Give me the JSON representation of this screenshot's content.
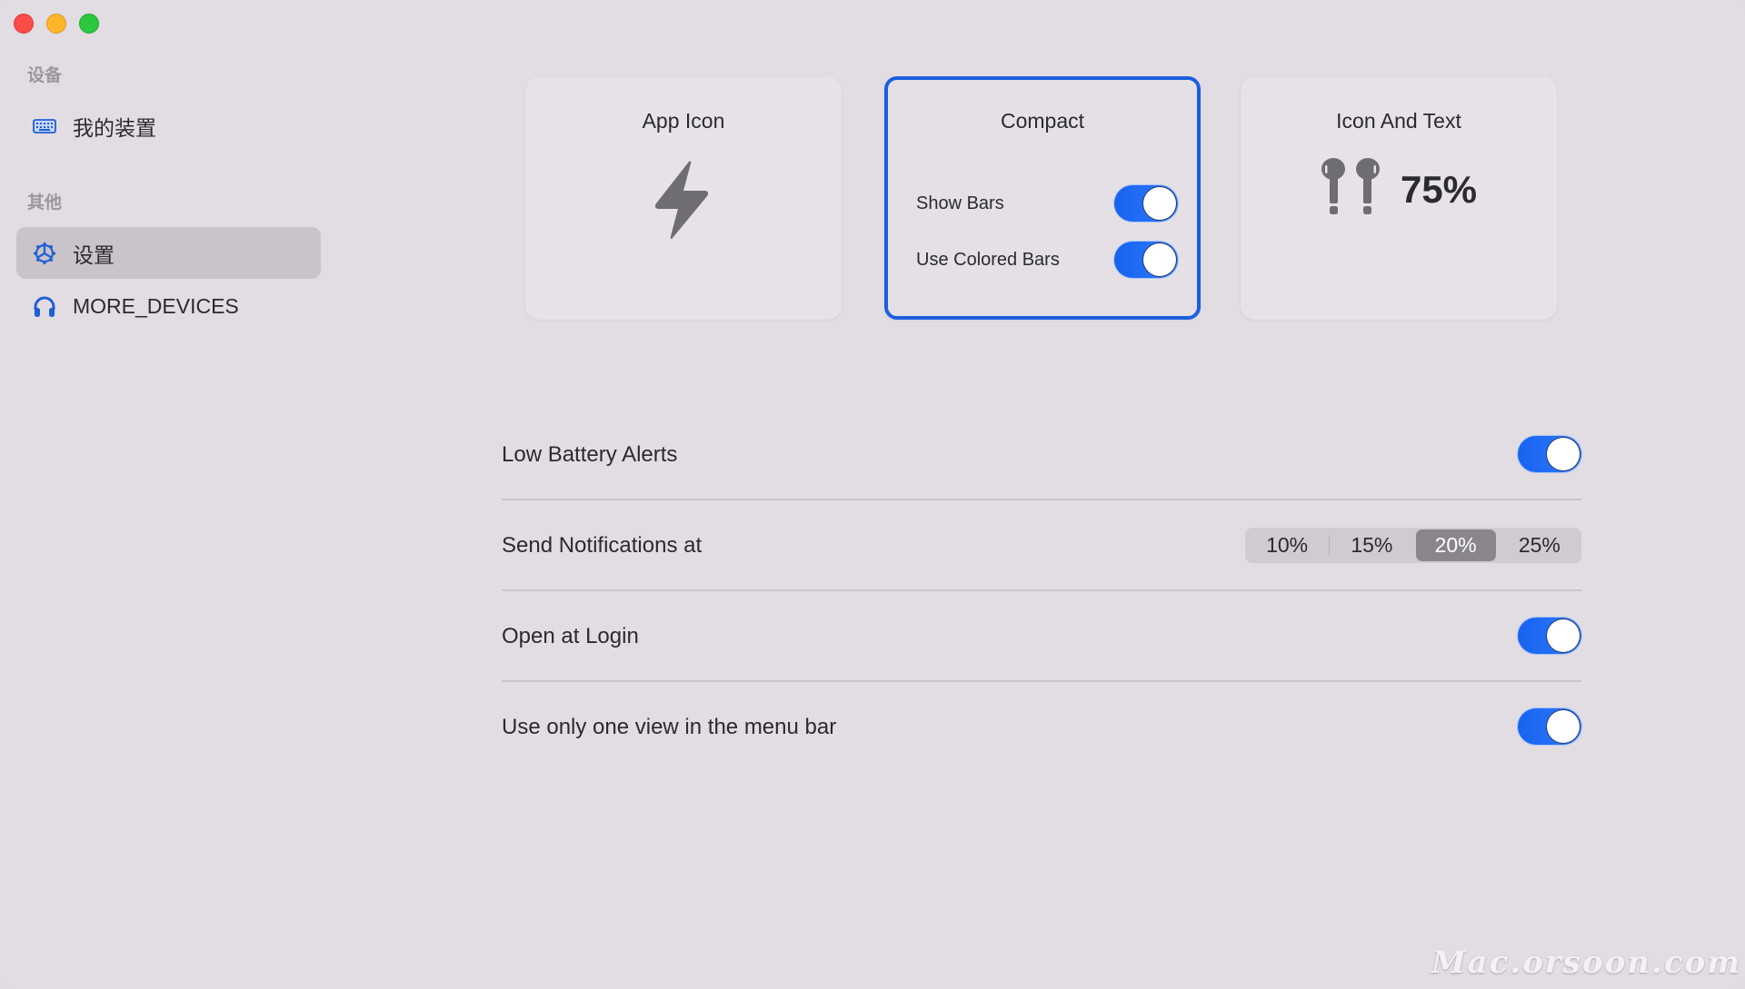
{
  "window": {
    "controls": [
      "close",
      "minimize",
      "maximize"
    ]
  },
  "sidebar": {
    "sections": [
      {
        "header": "设备",
        "items": [
          {
            "label": "我的装置",
            "icon": "keyboard-icon",
            "selected": false
          }
        ]
      },
      {
        "header": "其他",
        "items": [
          {
            "label": "设置",
            "icon": "gear-icon",
            "selected": true
          },
          {
            "label": "MORE_DEVICES",
            "icon": "headphones-icon",
            "selected": false
          }
        ]
      }
    ]
  },
  "display_modes": {
    "selected": "Compact",
    "cards": [
      {
        "title": "App Icon",
        "icon": "bolt-icon"
      },
      {
        "title": "Compact",
        "options": [
          {
            "label": "Show Bars",
            "enabled": true
          },
          {
            "label": "Use Colored Bars",
            "enabled": true
          }
        ]
      },
      {
        "title": "Icon And Text",
        "icon": "airpods-icon",
        "value": "75%"
      }
    ]
  },
  "settings": {
    "low_battery_alerts": {
      "label": "Low Battery Alerts",
      "enabled": true
    },
    "send_notifications": {
      "label": "Send Notifications at",
      "options": [
        "10%",
        "15%",
        "20%",
        "25%"
      ],
      "selected": "20%"
    },
    "open_at_login": {
      "label": "Open at Login",
      "enabled": true
    },
    "one_view": {
      "label": "Use only one view in the menu bar",
      "enabled": true
    }
  },
  "colors": {
    "accent": "#1a5fe0",
    "toggle_on": "#1763ee",
    "segment_active": "#8a858b"
  },
  "watermark": "Mac.orsoon.com"
}
